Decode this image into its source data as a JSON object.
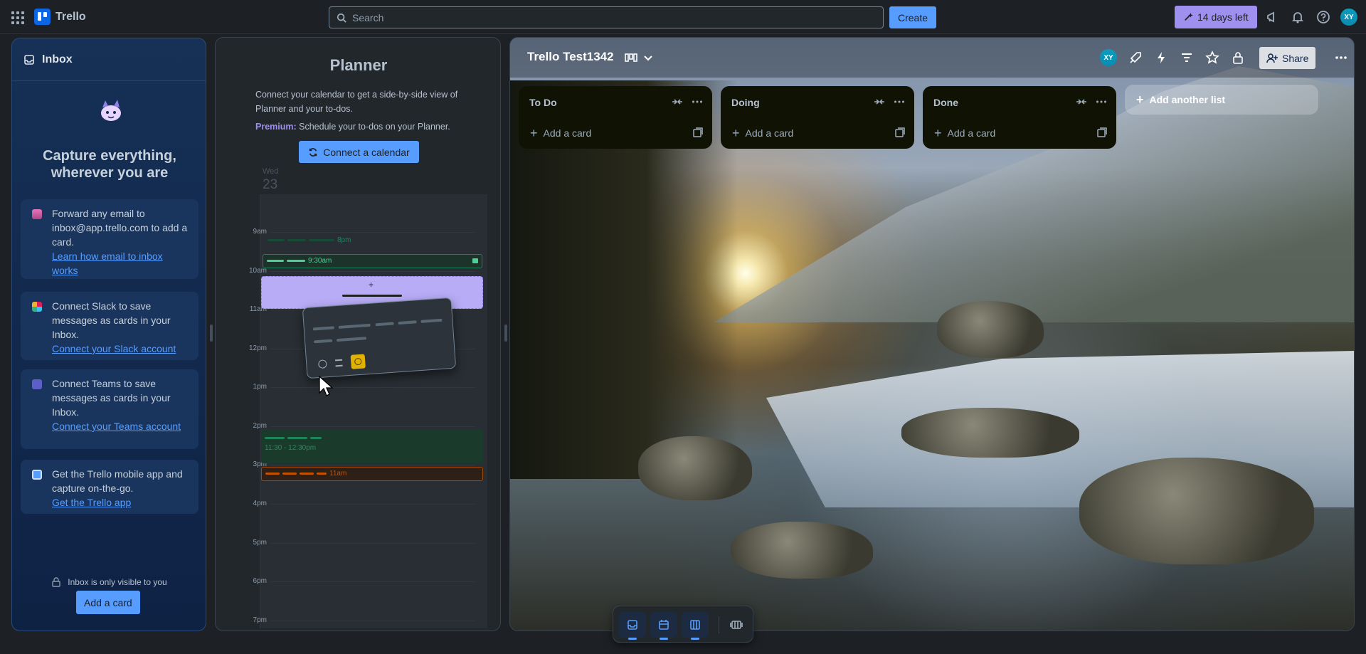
{
  "topbar": {
    "app_name": "Trello",
    "search_placeholder": "Search",
    "create_label": "Create",
    "trial_label": "14 days left",
    "avatar_initials": "XY"
  },
  "inbox": {
    "title": "Inbox",
    "headline": "Capture everything, wherever you are",
    "tips": [
      {
        "text": "Forward any email to inbox@app.trello.com to add a card.",
        "link": "Learn how email to inbox works",
        "icon": "email-icon"
      },
      {
        "text": "Connect Slack to save messages as cards in your Inbox.",
        "link": "Connect your Slack account",
        "icon": "slack-icon"
      },
      {
        "text": "Connect Teams to save messages as cards in your Inbox.",
        "link": "Connect your Teams account",
        "icon": "teams-icon"
      },
      {
        "text": "Get the Trello mobile app and capture on-the-go.",
        "link": "Get the Trello app",
        "icon": "mobile-app-icon"
      }
    ],
    "visibility_note": "Inbox is only visible to you",
    "add_card_label": "Add a card"
  },
  "planner": {
    "title": "Planner",
    "description": "Connect your calendar to get a side-by-side view of Planner and your to-dos.",
    "premium_label": "Premium:",
    "premium_text": "Schedule your to-dos on your Planner.",
    "connect_label": "Connect a calendar",
    "day_name": "Wed",
    "day_number": "23",
    "hours": [
      "9am",
      "10am",
      "11am",
      "12pm",
      "1pm",
      "2pm",
      "3pm",
      "4pm",
      "5pm",
      "6pm",
      "7pm"
    ],
    "events": {
      "e1": "8pm",
      "e2": "9:30am",
      "e3": "11:30 - 12:30pm",
      "e4": "11am"
    }
  },
  "board": {
    "title": "Trello Test1342",
    "share_label": "Share",
    "avatar_initials": "XY",
    "lists": [
      {
        "title": "To Do",
        "add_label": "Add a card"
      },
      {
        "title": "Doing",
        "add_label": "Add a card"
      },
      {
        "title": "Done",
        "add_label": "Add a card"
      }
    ],
    "add_list_label": "Add another list"
  },
  "colors": {
    "accent": "#579dff",
    "premium": "#9f8fef",
    "event_green": "#1f845a",
    "event_orange": "#c25100",
    "event_purple": "#b8acf6"
  }
}
